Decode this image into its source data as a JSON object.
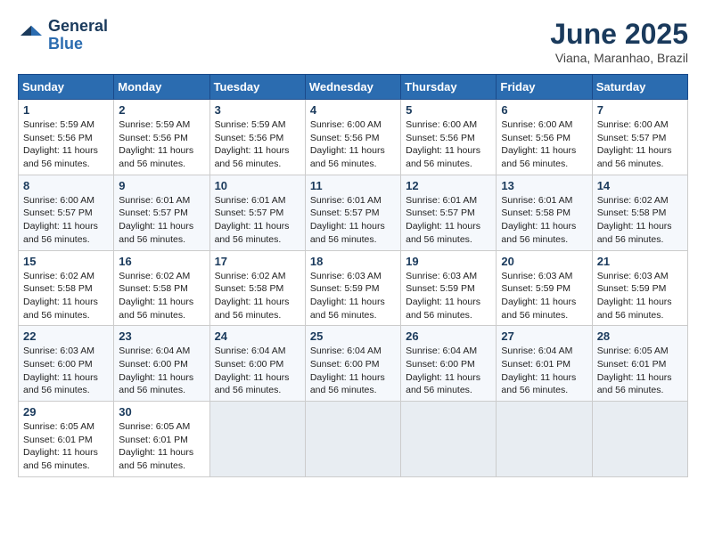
{
  "logo": {
    "line1": "General",
    "line2": "Blue"
  },
  "title": "June 2025",
  "subtitle": "Viana, Maranhao, Brazil",
  "days_of_week": [
    "Sunday",
    "Monday",
    "Tuesday",
    "Wednesday",
    "Thursday",
    "Friday",
    "Saturday"
  ],
  "weeks": [
    [
      {
        "day": 1,
        "sunrise": "5:59 AM",
        "sunset": "5:56 PM",
        "daylight": "11 hours and 56 minutes."
      },
      {
        "day": 2,
        "sunrise": "5:59 AM",
        "sunset": "5:56 PM",
        "daylight": "11 hours and 56 minutes."
      },
      {
        "day": 3,
        "sunrise": "5:59 AM",
        "sunset": "5:56 PM",
        "daylight": "11 hours and 56 minutes."
      },
      {
        "day": 4,
        "sunrise": "6:00 AM",
        "sunset": "5:56 PM",
        "daylight": "11 hours and 56 minutes."
      },
      {
        "day": 5,
        "sunrise": "6:00 AM",
        "sunset": "5:56 PM",
        "daylight": "11 hours and 56 minutes."
      },
      {
        "day": 6,
        "sunrise": "6:00 AM",
        "sunset": "5:56 PM",
        "daylight": "11 hours and 56 minutes."
      },
      {
        "day": 7,
        "sunrise": "6:00 AM",
        "sunset": "5:57 PM",
        "daylight": "11 hours and 56 minutes."
      }
    ],
    [
      {
        "day": 8,
        "sunrise": "6:00 AM",
        "sunset": "5:57 PM",
        "daylight": "11 hours and 56 minutes."
      },
      {
        "day": 9,
        "sunrise": "6:01 AM",
        "sunset": "5:57 PM",
        "daylight": "11 hours and 56 minutes."
      },
      {
        "day": 10,
        "sunrise": "6:01 AM",
        "sunset": "5:57 PM",
        "daylight": "11 hours and 56 minutes."
      },
      {
        "day": 11,
        "sunrise": "6:01 AM",
        "sunset": "5:57 PM",
        "daylight": "11 hours and 56 minutes."
      },
      {
        "day": 12,
        "sunrise": "6:01 AM",
        "sunset": "5:57 PM",
        "daylight": "11 hours and 56 minutes."
      },
      {
        "day": 13,
        "sunrise": "6:01 AM",
        "sunset": "5:58 PM",
        "daylight": "11 hours and 56 minutes."
      },
      {
        "day": 14,
        "sunrise": "6:02 AM",
        "sunset": "5:58 PM",
        "daylight": "11 hours and 56 minutes."
      }
    ],
    [
      {
        "day": 15,
        "sunrise": "6:02 AM",
        "sunset": "5:58 PM",
        "daylight": "11 hours and 56 minutes."
      },
      {
        "day": 16,
        "sunrise": "6:02 AM",
        "sunset": "5:58 PM",
        "daylight": "11 hours and 56 minutes."
      },
      {
        "day": 17,
        "sunrise": "6:02 AM",
        "sunset": "5:58 PM",
        "daylight": "11 hours and 56 minutes."
      },
      {
        "day": 18,
        "sunrise": "6:03 AM",
        "sunset": "5:59 PM",
        "daylight": "11 hours and 56 minutes."
      },
      {
        "day": 19,
        "sunrise": "6:03 AM",
        "sunset": "5:59 PM",
        "daylight": "11 hours and 56 minutes."
      },
      {
        "day": 20,
        "sunrise": "6:03 AM",
        "sunset": "5:59 PM",
        "daylight": "11 hours and 56 minutes."
      },
      {
        "day": 21,
        "sunrise": "6:03 AM",
        "sunset": "5:59 PM",
        "daylight": "11 hours and 56 minutes."
      }
    ],
    [
      {
        "day": 22,
        "sunrise": "6:03 AM",
        "sunset": "6:00 PM",
        "daylight": "11 hours and 56 minutes."
      },
      {
        "day": 23,
        "sunrise": "6:04 AM",
        "sunset": "6:00 PM",
        "daylight": "11 hours and 56 minutes."
      },
      {
        "day": 24,
        "sunrise": "6:04 AM",
        "sunset": "6:00 PM",
        "daylight": "11 hours and 56 minutes."
      },
      {
        "day": 25,
        "sunrise": "6:04 AM",
        "sunset": "6:00 PM",
        "daylight": "11 hours and 56 minutes."
      },
      {
        "day": 26,
        "sunrise": "6:04 AM",
        "sunset": "6:00 PM",
        "daylight": "11 hours and 56 minutes."
      },
      {
        "day": 27,
        "sunrise": "6:04 AM",
        "sunset": "6:01 PM",
        "daylight": "11 hours and 56 minutes."
      },
      {
        "day": 28,
        "sunrise": "6:05 AM",
        "sunset": "6:01 PM",
        "daylight": "11 hours and 56 minutes."
      }
    ],
    [
      {
        "day": 29,
        "sunrise": "6:05 AM",
        "sunset": "6:01 PM",
        "daylight": "11 hours and 56 minutes."
      },
      {
        "day": 30,
        "sunrise": "6:05 AM",
        "sunset": "6:01 PM",
        "daylight": "11 hours and 56 minutes."
      },
      null,
      null,
      null,
      null,
      null
    ]
  ]
}
